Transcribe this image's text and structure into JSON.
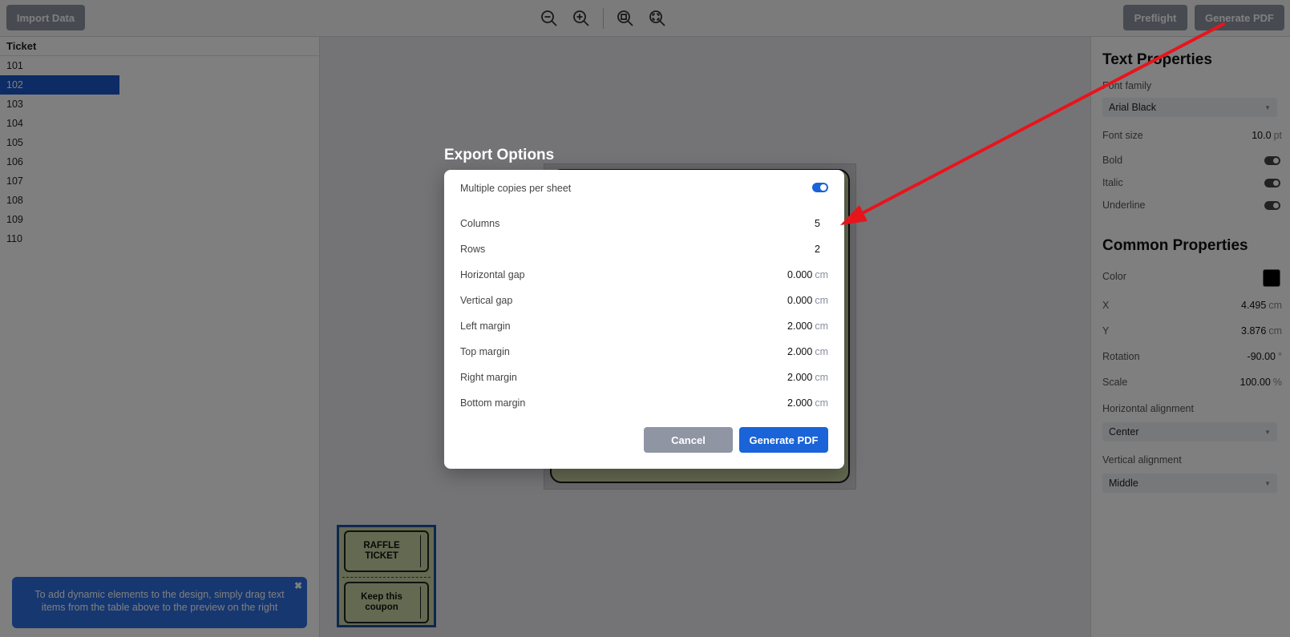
{
  "toolbar": {
    "import_label": "Import Data",
    "preflight_label": "Preflight",
    "generate_pdf_label": "Generate PDF"
  },
  "table": {
    "header": "Ticket",
    "rows": [
      "101",
      "102",
      "103",
      "104",
      "105",
      "106",
      "107",
      "108",
      "109",
      "110"
    ],
    "selected_row": "102"
  },
  "hint": {
    "text": "To add dynamic elements to the design, simply drag text items from the table above to the preview on the right",
    "close_symbol": "✖"
  },
  "thumbnail": {
    "top_text": "RAFFLE TICKET",
    "bottom_text": "Keep this coupon"
  },
  "text_properties": {
    "title": "Text Properties",
    "font_family_label": "Font family",
    "font_family_value": "Arial Black",
    "font_size_label": "Font size",
    "font_size_value": "10.0",
    "font_size_unit": "pt",
    "bold_label": "Bold",
    "italic_label": "Italic",
    "underline_label": "Underline"
  },
  "common_properties": {
    "title": "Common Properties",
    "color_label": "Color",
    "color_value": "#000000",
    "x_label": "X",
    "x_value": "4.495",
    "y_label": "Y",
    "y_value": "3.876",
    "rotation_label": "Rotation",
    "rotation_value": "-90.00",
    "rotation_unit": "°",
    "scale_label": "Scale",
    "scale_value": "100.00",
    "scale_unit": "%",
    "length_unit": "cm",
    "h_align_label": "Horizontal alignment",
    "h_align_value": "Center",
    "v_align_label": "Vertical alignment",
    "v_align_value": "Middle"
  },
  "modal": {
    "title": "Export Options",
    "multiple_copies_label": "Multiple copies per sheet",
    "multiple_copies_on": true,
    "unit": "cm",
    "columns_label": "Columns",
    "columns_value": "5",
    "rows_label": "Rows",
    "rows_value": "2",
    "h_gap_label": "Horizontal gap",
    "h_gap_value": "0.000",
    "v_gap_label": "Vertical gap",
    "v_gap_value": "0.000",
    "left_margin_label": "Left margin",
    "left_margin_value": "2.000",
    "top_margin_label": "Top margin",
    "top_margin_value": "2.000",
    "right_margin_label": "Right margin",
    "right_margin_value": "2.000",
    "bottom_margin_label": "Bottom margin",
    "bottom_margin_value": "2.000",
    "cancel_label": "Cancel",
    "generate_label": "Generate PDF"
  },
  "colors": {
    "accent": "#1a63d8",
    "annotation_arrow": "#e8141c"
  }
}
